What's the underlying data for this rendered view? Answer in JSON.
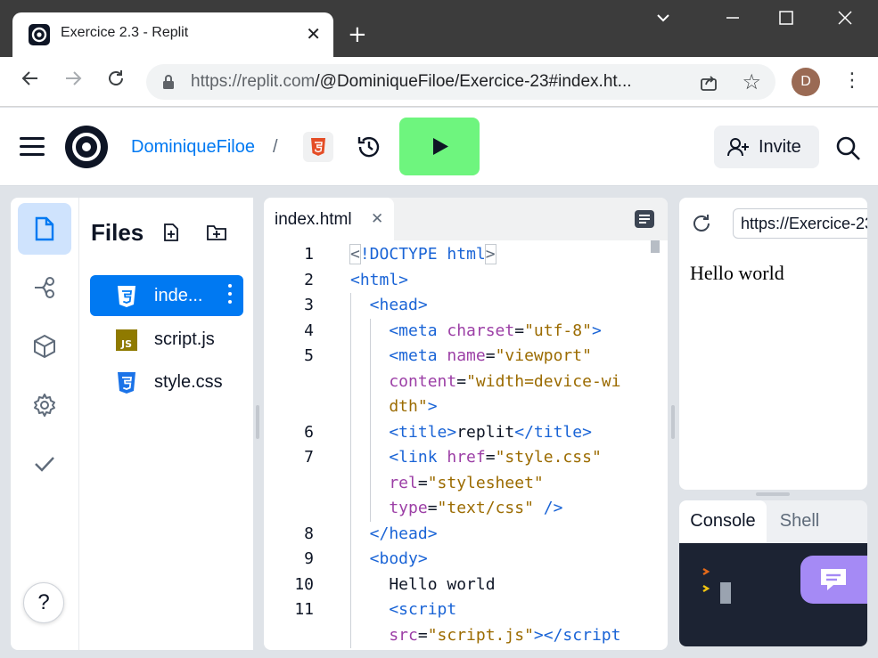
{
  "browser": {
    "tab_title": "Exercice 2.3 - Replit",
    "tab_close": "✕",
    "new_tab": "+",
    "url_host": "https://replit.com",
    "url_path": "/@DominiqueFiloe/Exercice-23#index.ht...",
    "profile_initial": "D"
  },
  "header": {
    "owner": "DominiqueFiloe",
    "separator": "/",
    "invite_label": "Invite"
  },
  "files": {
    "title": "Files",
    "items": [
      {
        "name": "inde...",
        "type": "html",
        "active": true
      },
      {
        "name": "script.js",
        "type": "js",
        "active": false
      },
      {
        "name": "style.css",
        "type": "css",
        "active": false
      }
    ]
  },
  "editor": {
    "tab_label": "index.html",
    "tab_close": "✕",
    "lines": [
      {
        "num": "1",
        "parts": [
          [
            "punc",
            "<"
          ],
          [
            "tag",
            "!DOCTYPE"
          ],
          [
            "txt",
            " "
          ],
          [
            "tag",
            "html"
          ],
          [
            "punc",
            ">"
          ]
        ]
      },
      {
        "num": "2",
        "parts": [
          [
            "tag",
            "<html>"
          ]
        ]
      },
      {
        "num": "3",
        "parts": [
          [
            "tag",
            "  <head>"
          ]
        ]
      },
      {
        "num": "4",
        "parts": [
          [
            "tag",
            "    <meta "
          ],
          [
            "attr",
            "charset"
          ],
          [
            "txt",
            "="
          ],
          [
            "str",
            "\"utf-8\""
          ],
          [
            "tag",
            ">"
          ]
        ]
      },
      {
        "num": "5",
        "parts": [
          [
            "tag",
            "    <meta "
          ],
          [
            "attr",
            "name"
          ],
          [
            "txt",
            "="
          ],
          [
            "str",
            "\"viewport\""
          ]
        ]
      },
      {
        "num": "",
        "parts": [
          [
            "attr",
            "    content"
          ],
          [
            "txt",
            "="
          ],
          [
            "str",
            "\"width=device-wi"
          ]
        ]
      },
      {
        "num": "",
        "parts": [
          [
            "str",
            "    dth\""
          ],
          [
            "tag",
            ">"
          ]
        ]
      },
      {
        "num": "6",
        "parts": [
          [
            "tag",
            "    <title>"
          ],
          [
            "txt",
            "replit"
          ],
          [
            "tag",
            "</title>"
          ]
        ]
      },
      {
        "num": "7",
        "parts": [
          [
            "tag",
            "    <link "
          ],
          [
            "attr",
            "href"
          ],
          [
            "txt",
            "="
          ],
          [
            "str",
            "\"style.css\""
          ]
        ]
      },
      {
        "num": "",
        "parts": [
          [
            "attr",
            "    rel"
          ],
          [
            "txt",
            "="
          ],
          [
            "str",
            "\"stylesheet\""
          ]
        ]
      },
      {
        "num": "",
        "parts": [
          [
            "attr",
            "    type"
          ],
          [
            "txt",
            "="
          ],
          [
            "str",
            "\"text/css\""
          ],
          [
            "txt",
            " "
          ],
          [
            "tag",
            "/>"
          ]
        ]
      },
      {
        "num": "8",
        "parts": [
          [
            "tag",
            "  </head>"
          ]
        ]
      },
      {
        "num": "9",
        "parts": [
          [
            "tag",
            "  <body>"
          ]
        ]
      },
      {
        "num": "10",
        "parts": [
          [
            "txt",
            "    Hello world"
          ]
        ]
      },
      {
        "num": "11",
        "parts": [
          [
            "tag",
            "    <script"
          ]
        ]
      },
      {
        "num": "",
        "parts": [
          [
            "attr",
            "    src"
          ],
          [
            "txt",
            "="
          ],
          [
            "str",
            "\"script.js\""
          ],
          [
            "tag",
            "></script"
          ]
        ]
      }
    ]
  },
  "webview": {
    "url": "https://Exercice-23",
    "content": "Hello world"
  },
  "console": {
    "tabs": [
      "Console",
      "Shell"
    ]
  },
  "colors": {
    "accent": "#0079f2",
    "run": "#6ef57e",
    "terminal_bg": "#1c2333",
    "chat": "#a58af5"
  }
}
